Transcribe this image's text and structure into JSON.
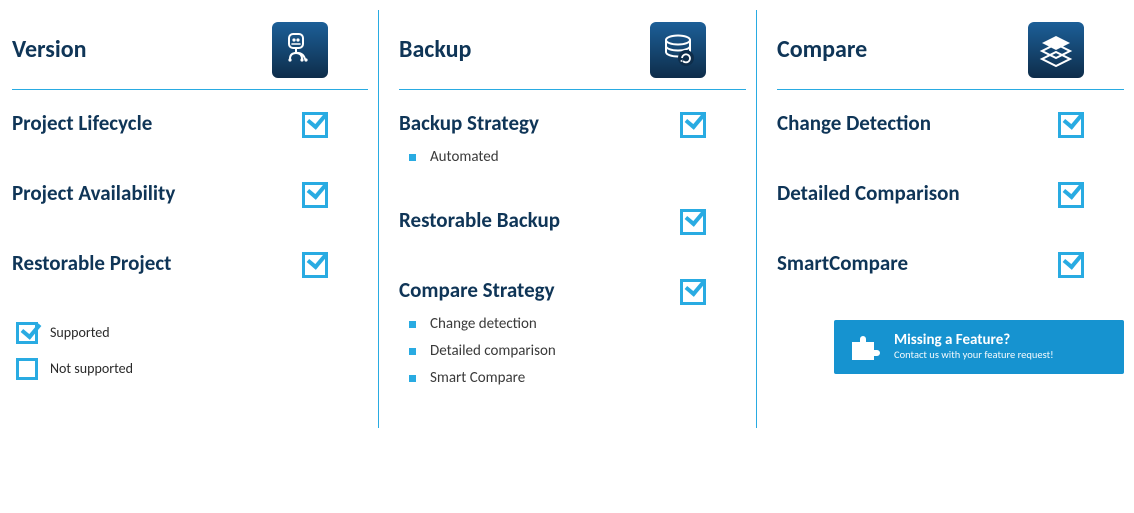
{
  "columns": [
    {
      "title": "Version",
      "icon": "robot-icon",
      "features": [
        {
          "label": "Project Lifecycle",
          "checked": true,
          "sub": []
        },
        {
          "label": "Project Availability",
          "checked": true,
          "sub": []
        },
        {
          "label": "Restorable Project",
          "checked": true,
          "sub": []
        }
      ]
    },
    {
      "title": "Backup",
      "icon": "database-icon",
      "features": [
        {
          "label": "Backup Strategy",
          "checked": true,
          "sub": [
            "Automated"
          ]
        },
        {
          "label": "Restorable Backup",
          "checked": true,
          "sub": []
        },
        {
          "label": "Compare Strategy",
          "checked": true,
          "sub": [
            "Change detection",
            "Detailed comparison",
            "Smart Compare"
          ]
        }
      ]
    },
    {
      "title": "Compare",
      "icon": "layers-icon",
      "features": [
        {
          "label": "Change Detection",
          "checked": true,
          "sub": []
        },
        {
          "label": "Detailed Comparison",
          "checked": true,
          "sub": []
        },
        {
          "label": "SmartCompare",
          "checked": true,
          "sub": []
        }
      ]
    }
  ],
  "legend": {
    "supported": "Supported",
    "not_supported": "Not supported"
  },
  "cta": {
    "title": "Missing a Feature?",
    "subtitle": "Contact us with your feature request!"
  }
}
